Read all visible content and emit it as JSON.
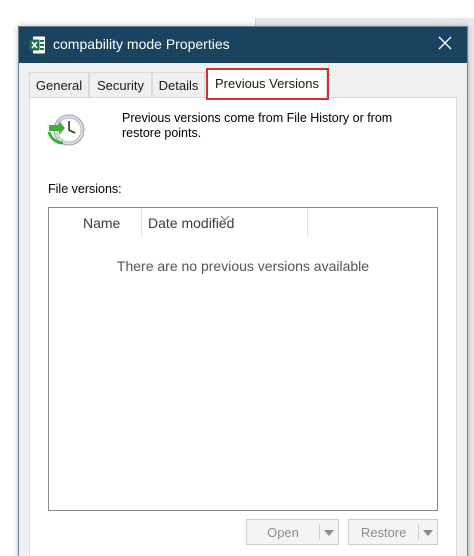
{
  "window": {
    "title": "compability mode Properties",
    "app_icon": "excel-file-icon",
    "close_icon": "close-icon"
  },
  "tabs": [
    {
      "label": "General",
      "active": false
    },
    {
      "label": "Security",
      "active": false
    },
    {
      "label": "Details",
      "active": false
    },
    {
      "label": "Previous Versions",
      "active": true
    }
  ],
  "panel": {
    "icon": "file-history-clock-icon",
    "description": "Previous versions come from File History or from restore points.",
    "file_versions_label": "File versions:",
    "list": {
      "columns": [
        "Name",
        "Date modified"
      ],
      "empty_message": "There are no previous versions available"
    }
  },
  "buttons": {
    "open_label": "Open",
    "restore_label": "Restore",
    "enabled": false
  },
  "colors": {
    "titlebar": "#19435f",
    "highlight": "#d32f2f",
    "excel_green": "#1d7044"
  }
}
